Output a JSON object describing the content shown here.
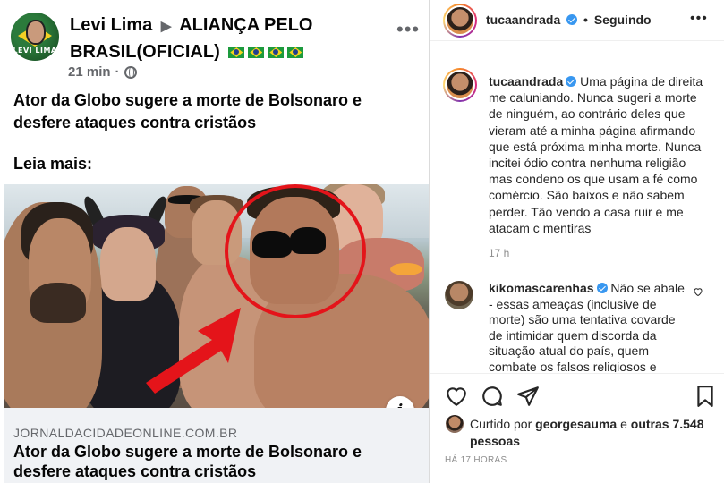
{
  "facebook_post": {
    "author": "Levi Lima",
    "group": "ALIANÇA PELO BRASIL(OFICIAL)",
    "avatar_tag": "LEVI LIMA",
    "timestamp": "21 min",
    "headline": "Ator da Globo sugere a morte de Bolsonaro e desfere ataques contra cristãos",
    "read_more": "Leia mais:",
    "link": {
      "domain": "JORNALDACIDADEONLINE.COM.BR",
      "title": "Ator da Globo sugere a morte de Bolsonaro e desfere ataques contra cristãos"
    },
    "info_button": "i",
    "more_icon": "•••"
  },
  "instagram": {
    "username": "tucaandrada",
    "follow_status": "Seguindo",
    "more_icon": "•••",
    "caption": {
      "username": "tucaandrada",
      "text": "Uma página de direita me caluniando. Nunca sugeri a morte de ninguém, ao contrário deles que vieram até a minha página afirmando que está próxima minha morte. Nunca incitei ódio contra nenhuma religião mas condeno os que usam a fé como comércio. São baixos e não sabem perder. Tão vendo a casa ruir e me atacam c mentiras",
      "time": "17 h"
    },
    "comment": {
      "username": "kikomascarenhas",
      "text": "Não se abale - essas ameaças (inclusive de morte) são uma tentativa covarde de intimidar quem discorda da situação atual do país, quem combate os falsos religiosos e"
    },
    "likes": {
      "prefix": "Curtido por",
      "user": "georgesauma",
      "and": "e",
      "others": "outras 7.548 pessoas"
    },
    "post_time": "HÁ 17 HORAS"
  },
  "colors": {
    "red_circle": "#e4141a",
    "verified_blue": "#3897f0",
    "fb_grey": "#65676b"
  }
}
